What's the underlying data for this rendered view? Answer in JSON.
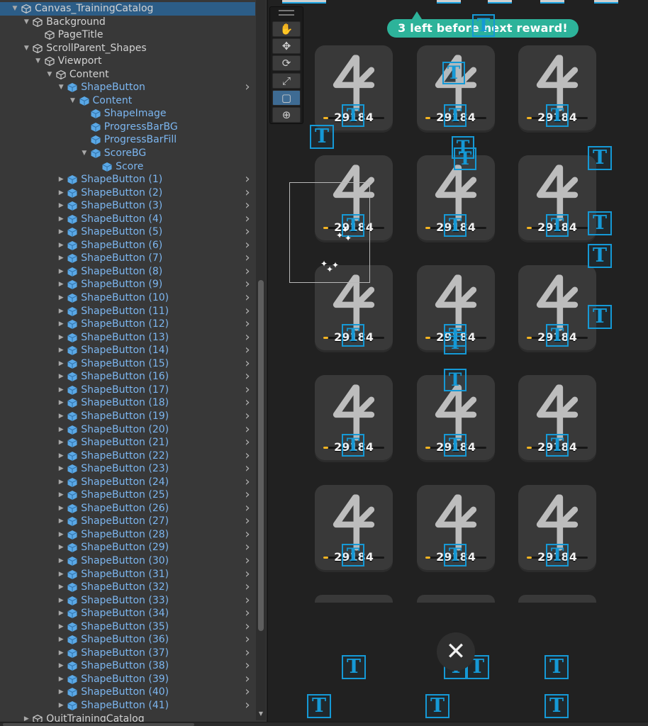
{
  "hierarchy": {
    "items": [
      {
        "label": "Canvas_TrainingCatalog",
        "depth": 0,
        "arrow": "expanded",
        "prefab": false,
        "selected": true,
        "chevron": false
      },
      {
        "label": "Background",
        "depth": 1,
        "arrow": "expanded",
        "prefab": false,
        "chevron": false
      },
      {
        "label": "PageTitle",
        "depth": 2,
        "arrow": "none",
        "prefab": false,
        "chevron": false
      },
      {
        "label": "ScrollParent_Shapes",
        "depth": 1,
        "arrow": "expanded",
        "prefab": false,
        "chevron": false
      },
      {
        "label": "Viewport",
        "depth": 2,
        "arrow": "expanded",
        "prefab": false,
        "chevron": false
      },
      {
        "label": "Content",
        "depth": 3,
        "arrow": "expanded",
        "prefab": false,
        "chevron": false
      },
      {
        "label": "ShapeButton",
        "depth": 4,
        "arrow": "expanded",
        "prefab": true,
        "chevron": true
      },
      {
        "label": "Content",
        "depth": 5,
        "arrow": "expanded",
        "prefab": true,
        "chevron": false
      },
      {
        "label": "ShapeImage",
        "depth": 6,
        "arrow": "none",
        "prefab": true,
        "chevron": false
      },
      {
        "label": "ProgressBarBG",
        "depth": 6,
        "arrow": "none",
        "prefab": true,
        "chevron": false
      },
      {
        "label": "ProgressBarFill",
        "depth": 6,
        "arrow": "none",
        "prefab": true,
        "chevron": false
      },
      {
        "label": "ScoreBG",
        "depth": 6,
        "arrow": "expanded",
        "prefab": true,
        "chevron": false
      },
      {
        "label": "Score",
        "depth": 7,
        "arrow": "none",
        "prefab": true,
        "chevron": false
      },
      {
        "label": "ShapeButton (1)",
        "depth": 4,
        "arrow": "collapsed",
        "prefab": true,
        "chevron": true
      },
      {
        "label": "ShapeButton (2)",
        "depth": 4,
        "arrow": "collapsed",
        "prefab": true,
        "chevron": true
      },
      {
        "label": "ShapeButton (3)",
        "depth": 4,
        "arrow": "collapsed",
        "prefab": true,
        "chevron": true
      },
      {
        "label": "ShapeButton (4)",
        "depth": 4,
        "arrow": "collapsed",
        "prefab": true,
        "chevron": true
      },
      {
        "label": "ShapeButton (5)",
        "depth": 4,
        "arrow": "collapsed",
        "prefab": true,
        "chevron": true
      },
      {
        "label": "ShapeButton (6)",
        "depth": 4,
        "arrow": "collapsed",
        "prefab": true,
        "chevron": true
      },
      {
        "label": "ShapeButton (7)",
        "depth": 4,
        "arrow": "collapsed",
        "prefab": true,
        "chevron": true
      },
      {
        "label": "ShapeButton (8)",
        "depth": 4,
        "arrow": "collapsed",
        "prefab": true,
        "chevron": true
      },
      {
        "label": "ShapeButton (9)",
        "depth": 4,
        "arrow": "collapsed",
        "prefab": true,
        "chevron": true
      },
      {
        "label": "ShapeButton (10)",
        "depth": 4,
        "arrow": "collapsed",
        "prefab": true,
        "chevron": true
      },
      {
        "label": "ShapeButton (11)",
        "depth": 4,
        "arrow": "collapsed",
        "prefab": true,
        "chevron": true
      },
      {
        "label": "ShapeButton (12)",
        "depth": 4,
        "arrow": "collapsed",
        "prefab": true,
        "chevron": true
      },
      {
        "label": "ShapeButton (13)",
        "depth": 4,
        "arrow": "collapsed",
        "prefab": true,
        "chevron": true
      },
      {
        "label": "ShapeButton (14)",
        "depth": 4,
        "arrow": "collapsed",
        "prefab": true,
        "chevron": true
      },
      {
        "label": "ShapeButton (15)",
        "depth": 4,
        "arrow": "collapsed",
        "prefab": true,
        "chevron": true
      },
      {
        "label": "ShapeButton (16)",
        "depth": 4,
        "arrow": "collapsed",
        "prefab": true,
        "chevron": true
      },
      {
        "label": "ShapeButton (17)",
        "depth": 4,
        "arrow": "collapsed",
        "prefab": true,
        "chevron": true
      },
      {
        "label": "ShapeButton (18)",
        "depth": 4,
        "arrow": "collapsed",
        "prefab": true,
        "chevron": true
      },
      {
        "label": "ShapeButton (19)",
        "depth": 4,
        "arrow": "collapsed",
        "prefab": true,
        "chevron": true
      },
      {
        "label": "ShapeButton (20)",
        "depth": 4,
        "arrow": "collapsed",
        "prefab": true,
        "chevron": true
      },
      {
        "label": "ShapeButton (21)",
        "depth": 4,
        "arrow": "collapsed",
        "prefab": true,
        "chevron": true
      },
      {
        "label": "ShapeButton (22)",
        "depth": 4,
        "arrow": "collapsed",
        "prefab": true,
        "chevron": true
      },
      {
        "label": "ShapeButton (23)",
        "depth": 4,
        "arrow": "collapsed",
        "prefab": true,
        "chevron": true
      },
      {
        "label": "ShapeButton (24)",
        "depth": 4,
        "arrow": "collapsed",
        "prefab": true,
        "chevron": true
      },
      {
        "label": "ShapeButton (25)",
        "depth": 4,
        "arrow": "collapsed",
        "prefab": true,
        "chevron": true
      },
      {
        "label": "ShapeButton (26)",
        "depth": 4,
        "arrow": "collapsed",
        "prefab": true,
        "chevron": true
      },
      {
        "label": "ShapeButton (27)",
        "depth": 4,
        "arrow": "collapsed",
        "prefab": true,
        "chevron": true
      },
      {
        "label": "ShapeButton (28)",
        "depth": 4,
        "arrow": "collapsed",
        "prefab": true,
        "chevron": true
      },
      {
        "label": "ShapeButton (29)",
        "depth": 4,
        "arrow": "collapsed",
        "prefab": true,
        "chevron": true
      },
      {
        "label": "ShapeButton (30)",
        "depth": 4,
        "arrow": "collapsed",
        "prefab": true,
        "chevron": true
      },
      {
        "label": "ShapeButton (31)",
        "depth": 4,
        "arrow": "collapsed",
        "prefab": true,
        "chevron": true
      },
      {
        "label": "ShapeButton (32)",
        "depth": 4,
        "arrow": "collapsed",
        "prefab": true,
        "chevron": true
      },
      {
        "label": "ShapeButton (33)",
        "depth": 4,
        "arrow": "collapsed",
        "prefab": true,
        "chevron": true
      },
      {
        "label": "ShapeButton (34)",
        "depth": 4,
        "arrow": "collapsed",
        "prefab": true,
        "chevron": true
      },
      {
        "label": "ShapeButton (35)",
        "depth": 4,
        "arrow": "collapsed",
        "prefab": true,
        "chevron": true
      },
      {
        "label": "ShapeButton (36)",
        "depth": 4,
        "arrow": "collapsed",
        "prefab": true,
        "chevron": true
      },
      {
        "label": "ShapeButton (37)",
        "depth": 4,
        "arrow": "collapsed",
        "prefab": true,
        "chevron": true
      },
      {
        "label": "ShapeButton (38)",
        "depth": 4,
        "arrow": "collapsed",
        "prefab": true,
        "chevron": true
      },
      {
        "label": "ShapeButton (39)",
        "depth": 4,
        "arrow": "collapsed",
        "prefab": true,
        "chevron": true
      },
      {
        "label": "ShapeButton (40)",
        "depth": 4,
        "arrow": "collapsed",
        "prefab": true,
        "chevron": true
      },
      {
        "label": "ShapeButton (41)",
        "depth": 4,
        "arrow": "collapsed",
        "prefab": true,
        "chevron": true
      },
      {
        "label": "QuitTrainingCatalog",
        "depth": 1,
        "arrow": "collapsed",
        "prefab": false,
        "chevron": false
      }
    ]
  },
  "toolbar": {
    "tools": [
      {
        "name": "hand-tool",
        "glyph": "✋",
        "active": false
      },
      {
        "name": "move-tool",
        "glyph": "✥",
        "active": false
      },
      {
        "name": "rotate-tool",
        "glyph": "⟳",
        "active": false
      },
      {
        "name": "scale-tool",
        "glyph": "⤢",
        "active": false
      },
      {
        "name": "rect-tool",
        "glyph": "▢",
        "active": true
      },
      {
        "name": "transform-tool",
        "glyph": "⊕",
        "active": false
      }
    ]
  },
  "scene": {
    "banner_text": "3 left before next reward!",
    "close_glyph": "✕",
    "gizmo_glyph": "T",
    "sparkle_glyph": "✦"
  },
  "cards": {
    "score": "29184",
    "progress_fraction": 0.08,
    "rows": 5,
    "cols": 3
  },
  "colors": {
    "accent_teal": "#2db39a",
    "selection_blue": "#2c5d87",
    "prefab_text": "#7cb6f0",
    "gizmo_blue": "#1599d6",
    "progress_fill": "#f5b523"
  }
}
